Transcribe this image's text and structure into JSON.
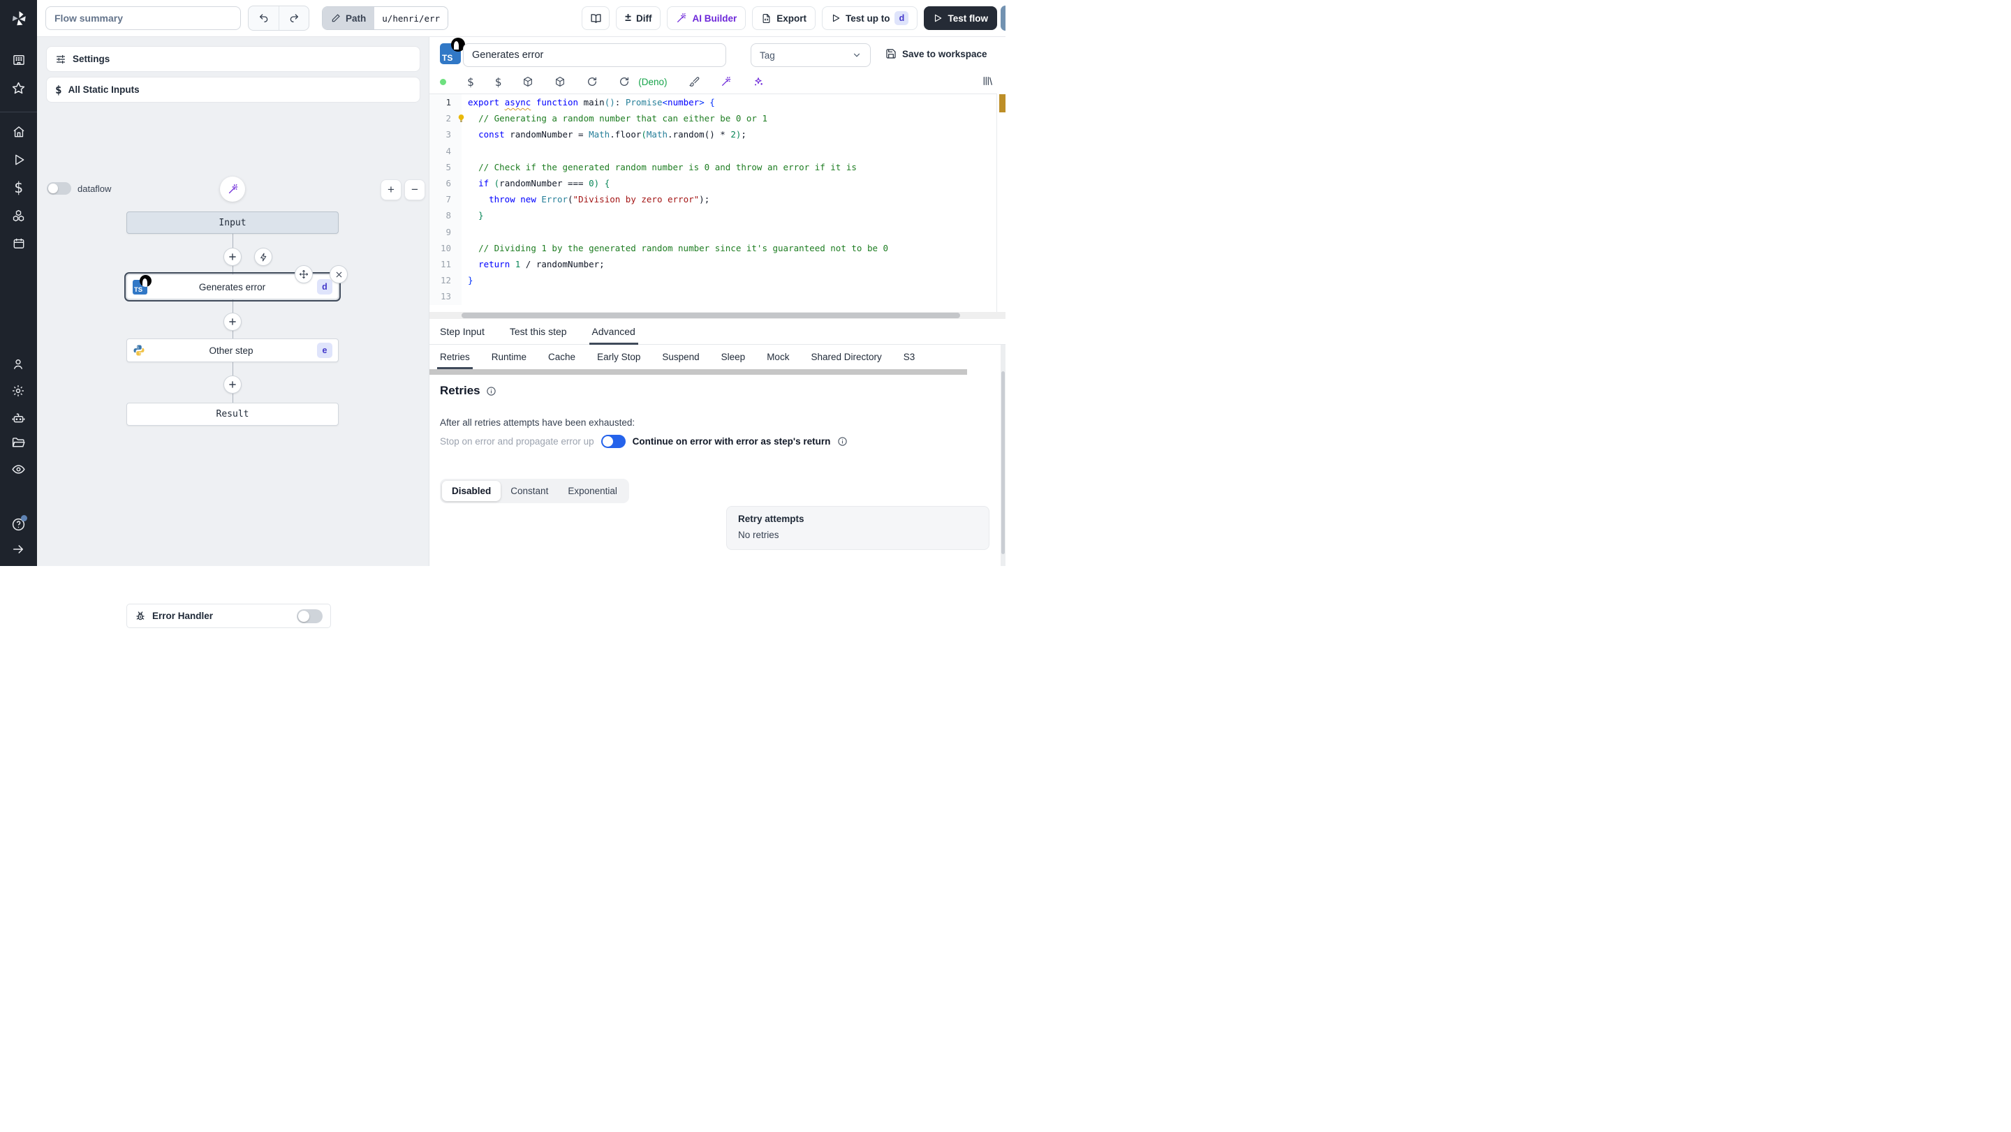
{
  "topbar": {
    "flow_summary_placeholder": "Flow summary",
    "path_label": "Path",
    "path_value": "u/henri/err",
    "diff_label": "Diff",
    "ai_builder_label": "AI Builder",
    "export_label": "Export",
    "test_up_to_label": "Test up to",
    "test_up_to_badge": "d",
    "test_flow_label": "Test flow"
  },
  "flow_panel": {
    "settings_label": "Settings",
    "all_static_inputs_label": "All Static Inputs",
    "dataflow_label": "dataflow",
    "input_node_label": "Input",
    "result_node_label": "Result",
    "error_handler_label": "Error Handler",
    "steps": [
      {
        "id": "d",
        "label": "Generates error",
        "language": "typescript-deno",
        "selected": true
      },
      {
        "id": "e",
        "label": "Other step",
        "language": "python",
        "selected": false
      }
    ]
  },
  "step_editor": {
    "language_badge": "TS",
    "name_value": "Generates error",
    "tag_placeholder": "Tag",
    "save_label": "Save to workspace",
    "runtime_label": "(Deno)",
    "code_lines": [
      {
        "n": "1",
        "segs": [
          [
            "export ",
            "kw"
          ],
          [
            "async",
            "kwu"
          ],
          [
            " ",
            "pl"
          ],
          [
            "function ",
            "kw"
          ],
          [
            "main",
            "pl"
          ],
          [
            "()",
            "ty"
          ],
          [
            ": ",
            "pl"
          ],
          [
            "Promise",
            "ty"
          ],
          [
            "<",
            "b1"
          ],
          [
            "number",
            "kw"
          ],
          [
            ">",
            "b1"
          ],
          [
            " {",
            "b1"
          ]
        ]
      },
      {
        "n": "2",
        "bulb": true,
        "segs": [
          [
            "  ",
            "pl"
          ],
          [
            "// Generating a random number that can either be 0 or 1",
            "cmt"
          ]
        ]
      },
      {
        "n": "3",
        "segs": [
          [
            "  ",
            "pl"
          ],
          [
            "const ",
            "kw"
          ],
          [
            "randomNumber = ",
            "pl"
          ],
          [
            "Math",
            "ty"
          ],
          [
            ".floor",
            "pl"
          ],
          [
            "(",
            "b2"
          ],
          [
            "Math",
            "ty"
          ],
          [
            ".random",
            "pl"
          ],
          [
            "() ",
            "pl"
          ],
          [
            "* ",
            "pl"
          ],
          [
            "2",
            "num"
          ],
          [
            ")",
            "b2"
          ],
          [
            ";",
            "pl"
          ]
        ]
      },
      {
        "n": "4",
        "segs": []
      },
      {
        "n": "5",
        "segs": [
          [
            "  ",
            "pl"
          ],
          [
            "// Check if the generated random number is 0 and throw an error if it is",
            "cmt"
          ]
        ]
      },
      {
        "n": "6",
        "segs": [
          [
            "  ",
            "pl"
          ],
          [
            "if ",
            "kw"
          ],
          [
            "(",
            "b2"
          ],
          [
            "randomNumber === ",
            "pl"
          ],
          [
            "0",
            "num"
          ],
          [
            ") {",
            "b2"
          ]
        ]
      },
      {
        "n": "7",
        "segs": [
          [
            "    ",
            "pl"
          ],
          [
            "throw ",
            "kw"
          ],
          [
            "new ",
            "kw"
          ],
          [
            "Error",
            "ty"
          ],
          [
            "(",
            "pl"
          ],
          [
            "\"Division by zero error\"",
            "str"
          ],
          [
            ");",
            "pl"
          ]
        ]
      },
      {
        "n": "8",
        "segs": [
          [
            "  }",
            "b2"
          ]
        ]
      },
      {
        "n": "9",
        "segs": []
      },
      {
        "n": "10",
        "segs": [
          [
            "  ",
            "pl"
          ],
          [
            "// Dividing 1 by the generated random number since it's guaranteed not to be 0",
            "cmt"
          ]
        ]
      },
      {
        "n": "11",
        "segs": [
          [
            "  ",
            "pl"
          ],
          [
            "return ",
            "kw"
          ],
          [
            "1",
            "num"
          ],
          [
            " / randomNumber;",
            "pl"
          ]
        ]
      },
      {
        "n": "12",
        "segs": [
          [
            "}",
            "b1"
          ]
        ]
      },
      {
        "n": "13",
        "segs": []
      }
    ]
  },
  "tabs": {
    "items": [
      "Step Input",
      "Test this step",
      "Advanced"
    ],
    "active": "Advanced"
  },
  "advanced_tabs": {
    "items": [
      "Retries",
      "Runtime",
      "Cache",
      "Early Stop",
      "Suspend",
      "Sleep",
      "Mock",
      "Shared Directory",
      "S3"
    ],
    "active": "Retries"
  },
  "retries": {
    "title": "Retries",
    "exhausted_text": "After all retries attempts have been exhausted:",
    "stop_option": "Stop on error and propagate error up",
    "continue_option": "Continue on error with error as step's return",
    "strategy_options": [
      "Disabled",
      "Constant",
      "Exponential"
    ],
    "strategy_active": "Disabled",
    "retry_box_title": "Retry attempts",
    "retry_box_value": "No retries"
  },
  "colors": {
    "rail_bg": "#1e232c",
    "accent_toggle_on": "#2563eb",
    "ai_purple": "#6d28d9",
    "deno_green": "#16a34a",
    "badge_bg": "#dfe4fb",
    "badge_text": "#4338ca",
    "ts_blue": "#3178c6",
    "overview_marker_gold": "#bd8e27"
  }
}
